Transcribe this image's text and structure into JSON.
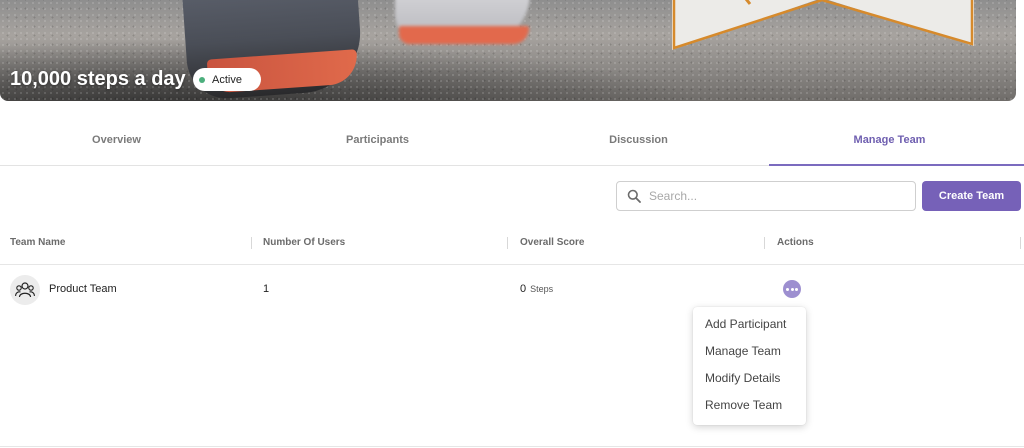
{
  "banner": {
    "title": "10,000 steps a day",
    "status": "Active",
    "status_color": "#4caf7d"
  },
  "tabs": [
    {
      "label": "Overview",
      "active": false
    },
    {
      "label": "Participants",
      "active": false
    },
    {
      "label": "Discussion",
      "active": false
    },
    {
      "label": "Manage Team",
      "active": true
    }
  ],
  "toolbar": {
    "search_placeholder": "Search...",
    "search_icon": "search-icon",
    "create_label": "Create Team"
  },
  "table": {
    "columns": [
      "Team Name",
      "Number Of Users",
      "Overall Score",
      "Actions"
    ],
    "rows": [
      {
        "icon": "team-icon",
        "name": "Product Team",
        "users": "1",
        "score": "0",
        "score_unit": "Steps",
        "action_icon": "more-options-icon"
      }
    ]
  },
  "actions_menu": {
    "items": [
      "Add Participant",
      "Manage Team",
      "Modify Details",
      "Remove Team"
    ]
  },
  "colors": {
    "accent": "#7661b8",
    "active_tab": "#6f5fb0"
  }
}
